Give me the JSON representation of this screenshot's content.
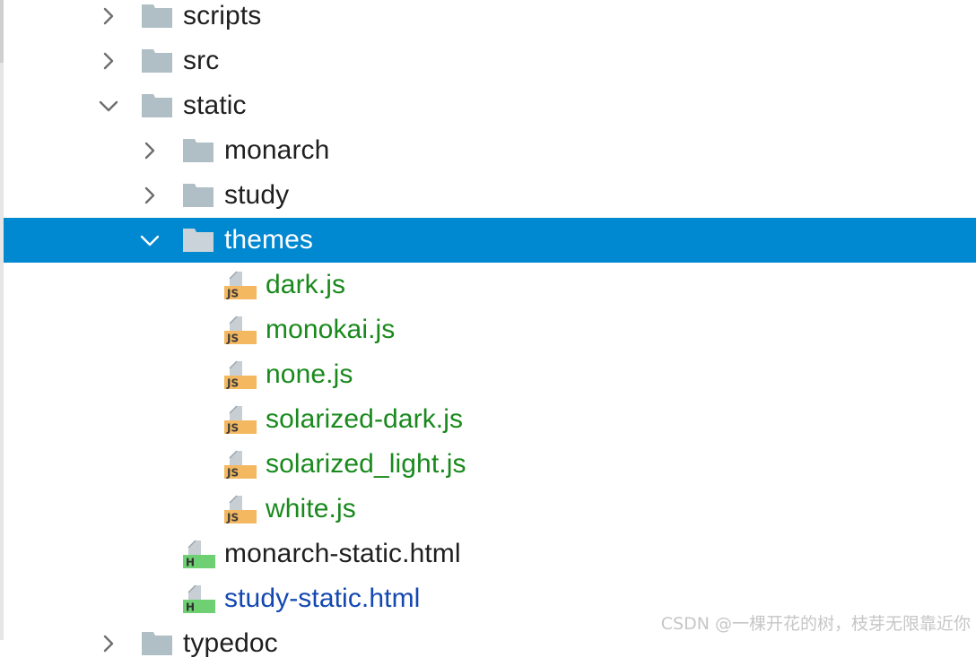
{
  "tree": {
    "items": [
      {
        "label": "scripts",
        "kind": "folder",
        "expanded": false
      },
      {
        "label": "src",
        "kind": "folder",
        "expanded": false
      },
      {
        "label": "static",
        "kind": "folder",
        "expanded": true
      },
      {
        "label": "monarch",
        "kind": "folder",
        "expanded": false
      },
      {
        "label": "study",
        "kind": "folder",
        "expanded": false
      },
      {
        "label": "themes",
        "kind": "folder",
        "expanded": true,
        "selected": true
      },
      {
        "label": "dark.js",
        "kind": "js-file",
        "status": "added"
      },
      {
        "label": "monokai.js",
        "kind": "js-file",
        "status": "added"
      },
      {
        "label": "none.js",
        "kind": "js-file",
        "status": "added"
      },
      {
        "label": "solarized-dark.js",
        "kind": "js-file",
        "status": "added"
      },
      {
        "label": "solarized_light.js",
        "kind": "js-file",
        "status": "added"
      },
      {
        "label": "white.js",
        "kind": "js-file",
        "status": "added"
      },
      {
        "label": "monarch-static.html",
        "kind": "html-file",
        "status": "unchanged"
      },
      {
        "label": "study-static.html",
        "kind": "html-file",
        "status": "modified"
      },
      {
        "label": "typedoc",
        "kind": "folder",
        "expanded": false
      }
    ]
  },
  "icons": {
    "folder": "folder-icon",
    "js": "js-file-icon",
    "html": "html-file-icon",
    "collapsed": "chevron-right-icon",
    "expanded": "chevron-down-icon"
  },
  "colors": {
    "selection": "#0088d1",
    "added_file": "#19891c",
    "modified_file": "#1348b0",
    "default_text": "#1f1f1f",
    "folder": "#b0bec5",
    "js_badge": "#f4b860",
    "html_badge": "#6fcf73"
  },
  "watermark": "CSDN @一棵开花的树，枝芽无限靠近你"
}
